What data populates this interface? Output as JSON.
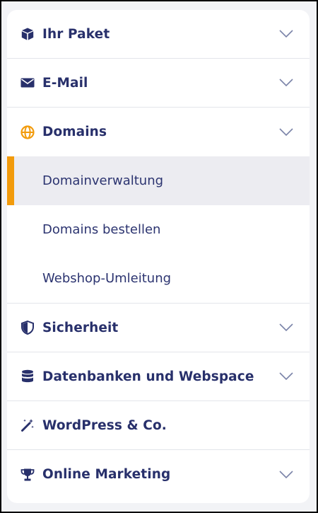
{
  "menu": {
    "sections": [
      {
        "label": "Ihr Paket",
        "icon": "package-icon",
        "expandable": true
      },
      {
        "label": "E-Mail",
        "icon": "envelope-icon",
        "expandable": true
      },
      {
        "label": "Domains",
        "icon": "globe-icon",
        "expandable": true,
        "expanded": true,
        "icon_color": "#f29b0c"
      },
      {
        "label": "Sicherheit",
        "icon": "shield-icon",
        "expandable": true
      },
      {
        "label": "Datenbanken und Webspace",
        "icon": "database-icon",
        "expandable": true
      },
      {
        "label": "WordPress & Co.",
        "icon": "magic-wand-icon",
        "expandable": false
      },
      {
        "label": "Online Marketing",
        "icon": "trophy-icon",
        "expandable": true
      }
    ],
    "domains_subitems": [
      {
        "label": "Domainverwaltung",
        "active": true
      },
      {
        "label": "Domains bestellen",
        "active": false
      },
      {
        "label": "Webshop-Umleitung",
        "active": false
      }
    ]
  },
  "colors": {
    "text": "#28306b",
    "accent": "#f29b0c",
    "active_bg": "#ececf1",
    "divider": "#e3e5ea",
    "chevron": "#7a83a8"
  }
}
